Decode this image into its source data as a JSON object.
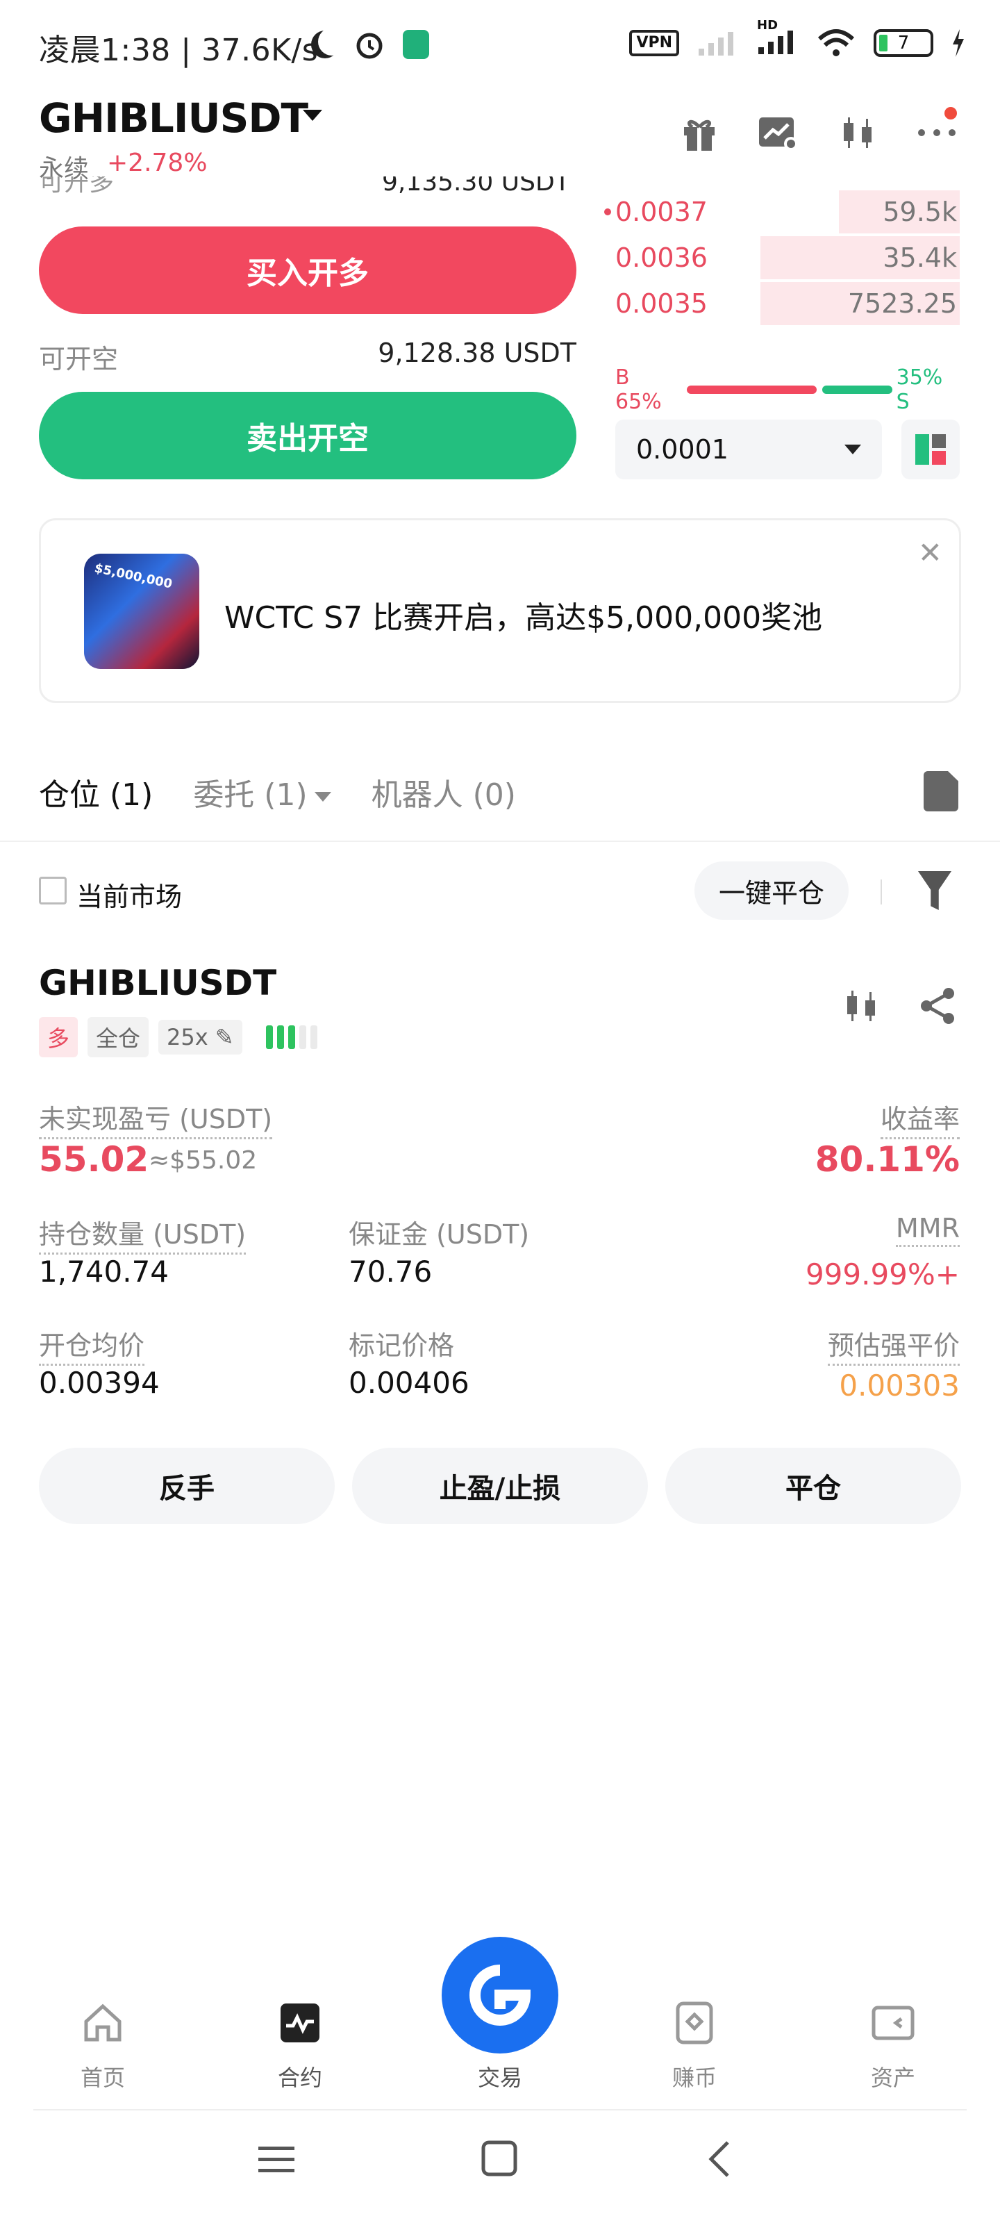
{
  "status_bar": {
    "time_speed": "凌晨1:38 | 37.6K/s",
    "vpn": "VPN",
    "network": "HD",
    "battery": "7"
  },
  "header": {
    "symbol": "GHIBLIUSDT",
    "contract_type": "永续",
    "change": "+2.78%",
    "icons": [
      "gift-icon",
      "chart-settings-icon",
      "candlestick-icon",
      "more-icon"
    ]
  },
  "trade_panel": {
    "open_long_label_cut": "可开多",
    "open_long_value_cut": "9,135.30 USDT",
    "buy_button": "买入开多",
    "open_short_label": "可开空",
    "open_short_value": "9,128.38 USDT",
    "sell_button": "卖出开空"
  },
  "orderbook": {
    "asks": [
      {
        "price": "0.0037",
        "qty": "59.5k",
        "depth": 0.34
      },
      {
        "price": "0.0036",
        "qty": "35.4k",
        "depth": 0.56
      },
      {
        "price": "0.0035",
        "qty": "7523.25",
        "depth": 0.56
      }
    ],
    "buy_ratio_label": "B 65%",
    "sell_ratio_label": "35% S",
    "buy_ratio": 0.65,
    "precision": "0.0001"
  },
  "banner": {
    "image_text": "$5,000,000",
    "text": "WCTC S7 比赛开启，高达$5,000,000奖池",
    "close": "✕"
  },
  "tabs": [
    {
      "label": "仓位 (1)",
      "active": true
    },
    {
      "label": "委托 (1)",
      "active": false
    },
    {
      "label": "机器人 (0)",
      "active": false
    }
  ],
  "filter": {
    "current_market": "当前市场",
    "close_all": "一键平仓"
  },
  "position": {
    "symbol": "GHIBLIUSDT",
    "side_tag": "多",
    "margin_tag": "全仓",
    "leverage_tag": "25x",
    "unrealized_pnl_label": "未实现盈亏 (USDT)",
    "unrealized_pnl": "55.02",
    "unrealized_pnl_approx": "≈$55.02",
    "roe_label": "收益率",
    "roe": "80.11%",
    "size_label": "持仓数量 (USDT)",
    "size": "1,740.74",
    "margin_label": "保证金 (USDT)",
    "margin": "70.76",
    "mmr_label": "MMR",
    "mmr": "999.99%+",
    "entry_label": "开仓均价",
    "entry": "0.00394",
    "mark_label": "标记价格",
    "mark": "0.00406",
    "liq_label": "预估强平价",
    "liq": "0.00303",
    "actions": [
      "反手",
      "止盈/止损",
      "平仓"
    ]
  },
  "bottom_nav": [
    {
      "label": "首页",
      "icon": "home-icon"
    },
    {
      "label": "合约",
      "icon": "futures-icon",
      "active": true
    },
    {
      "label": "交易",
      "icon": "trade-icon"
    },
    {
      "label": "赚币",
      "icon": "earn-icon"
    },
    {
      "label": "资产",
      "icon": "wallet-icon"
    }
  ],
  "colors": {
    "red": "#f2485f",
    "green": "#23bf7f",
    "orange": "#f5a14a",
    "blue": "#1a6ff0"
  }
}
